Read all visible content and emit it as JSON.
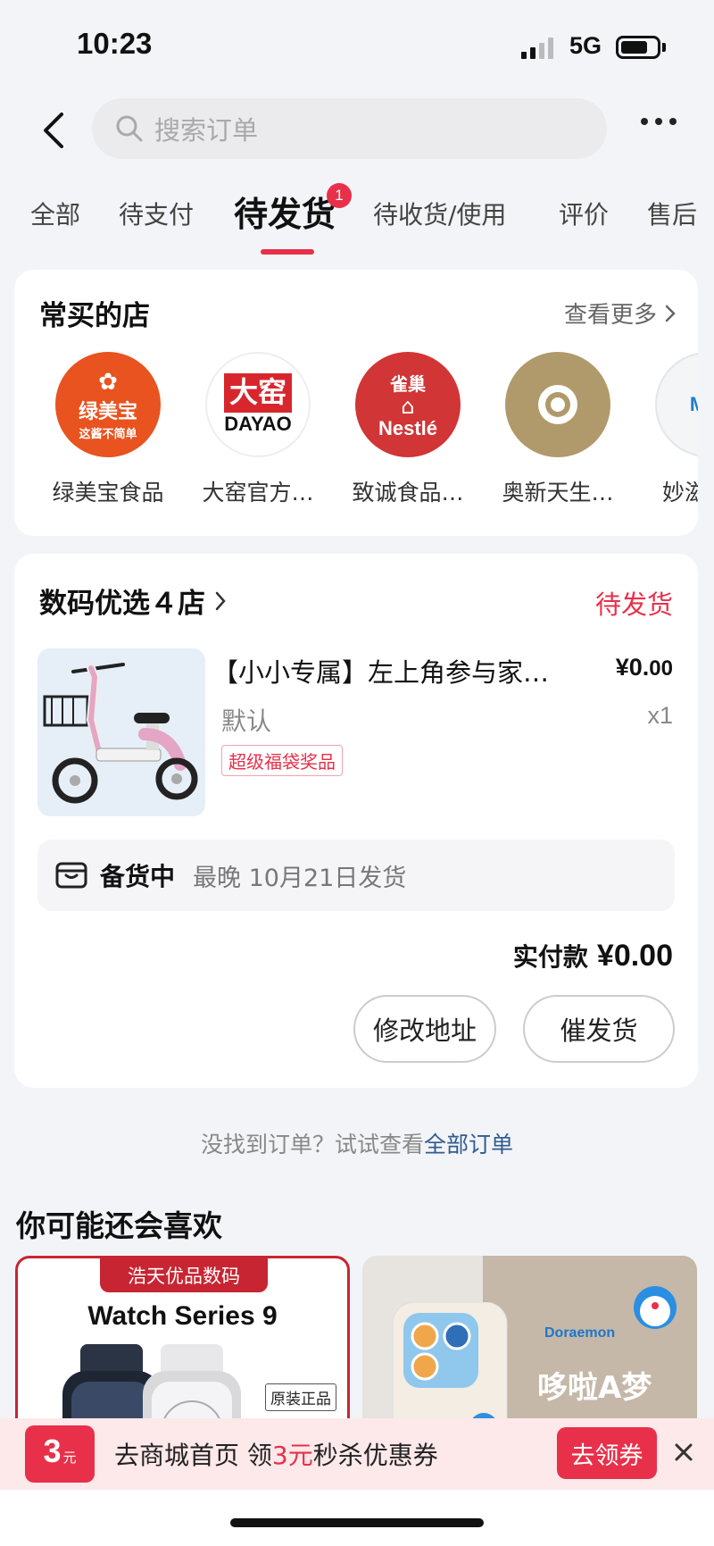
{
  "status_bar": {
    "time": "10:23",
    "network": "5G"
  },
  "header": {
    "search_placeholder": "搜索订单"
  },
  "tabs": [
    {
      "label": "全部"
    },
    {
      "label": "待支付"
    },
    {
      "label": "待发货",
      "active": true,
      "badge": "1"
    },
    {
      "label": "待收货/使用"
    },
    {
      "label": "评价"
    },
    {
      "label": "售后"
    }
  ],
  "frequent_stores": {
    "title": "常买的店",
    "see_more": "查看更多",
    "stores": [
      {
        "name": "绿美宝食品",
        "logo_text": "绿美宝",
        "logo_subtext": "这酱不简单",
        "logo_color": "#e8531f"
      },
      {
        "name": "大窑官方…",
        "logo_text": "大窑",
        "logo_subtext": "DAYAO",
        "logo_color": "#d7272d"
      },
      {
        "name": "致诚食品…",
        "logo_text": "雀巢",
        "logo_subtext": "Nestlé",
        "logo_color": "#d13536"
      },
      {
        "name": "奥新天生…",
        "logo_color": "#b09a6b"
      },
      {
        "name": "妙滋",
        "logo_text": "MIA",
        "logo_color": "#f3f5f7"
      }
    ]
  },
  "order": {
    "shop_name": "数码优选４店",
    "status": "待发货",
    "product_title": "【小小专属】左上角参与家…",
    "price_currency": "¥",
    "price_main": "0.",
    "price_cents": "00",
    "variant": "默认",
    "quantity": "x1",
    "tag": "超级福袋奖品",
    "shipping_status": "备货中",
    "shipping_note": "最晚 10月21日发货",
    "paid_label": "实付款",
    "paid_amount": "¥0.00",
    "btn_change_address": "修改地址",
    "btn_urge": "催发货"
  },
  "not_found": {
    "text": "没找到订单？试试查看",
    "link": "全部订单"
  },
  "recommend": {
    "title": "你可能还会喜欢",
    "cards": [
      {
        "banner": "浩天优品数码",
        "product": "Watch Series 9",
        "tag": "原装正品"
      },
      {
        "brand": "Doraemon",
        "text": "哆啦A梦"
      }
    ]
  },
  "coupon_bar": {
    "badge_num": "3",
    "badge_unit": "元",
    "text_before": "去商城首页 领",
    "text_highlight": "3元",
    "text_after": "秒杀优惠券",
    "claim_label": "去领券"
  },
  "colors": {
    "accent": "#e8304a",
    "link": "#2f5c8f"
  }
}
